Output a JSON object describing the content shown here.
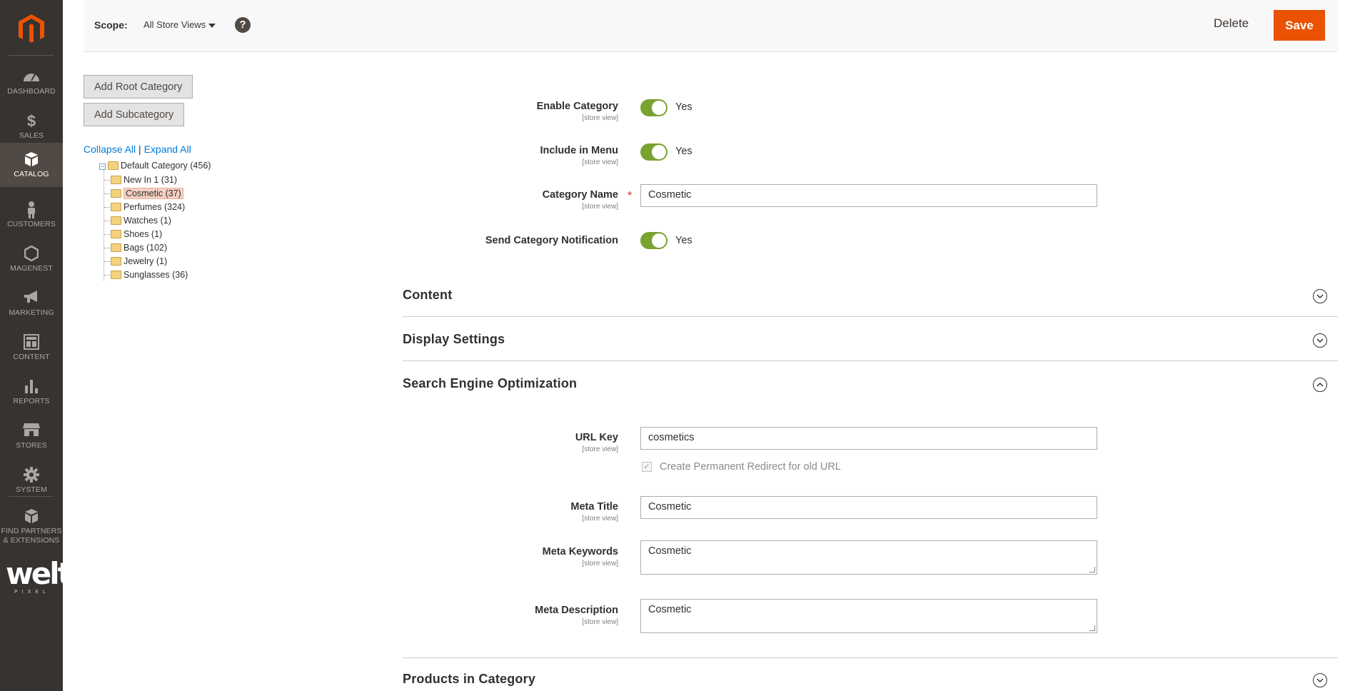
{
  "nav": {
    "items": [
      {
        "label": "DASHBOARD",
        "icon": "dashboard-gauge-icon"
      },
      {
        "label": "SALES",
        "icon": "dollar-icon"
      },
      {
        "label": "CATALOG",
        "icon": "box-icon"
      },
      {
        "label": "CUSTOMERS",
        "icon": "person-icon"
      },
      {
        "label": "MAGENEST",
        "icon": "hexagon-icon"
      },
      {
        "label": "MARKETING",
        "icon": "megaphone-icon"
      },
      {
        "label": "CONTENT",
        "icon": "layout-icon"
      },
      {
        "label": "REPORTS",
        "icon": "bar-chart-icon"
      },
      {
        "label": "STORES",
        "icon": "storefront-icon"
      },
      {
        "label": "SYSTEM",
        "icon": "gear-icon"
      }
    ],
    "partners_line1": "FIND PARTNERS",
    "partners_line2": "& EXTENSIONS",
    "brand_big": "welt",
    "brand_small": "PIXEL",
    "active": "CATALOG",
    "active_color": "#514943",
    "bg_color": "#373330"
  },
  "topbar": {
    "scope_label": "Scope:",
    "scope_value": "All Store Views",
    "help": "?",
    "delete_label": "Delete",
    "save_label": "Save",
    "save_color": "#eb5202"
  },
  "tree": {
    "add_root_label": "Add Root Category",
    "add_sub_label": "Add Subcategory",
    "collapse_all": "Collapse All",
    "separator": "|",
    "expand_all": "Expand All",
    "root": "Default Category (456)",
    "children": [
      "New In 1 (31)",
      "Cosmetic (37)",
      "Perfumes (324)",
      "Watches (1)",
      "Shoes (1)",
      "Bags (102)",
      "Jewelry (1)",
      "Sunglasses (36)"
    ],
    "selected": "Cosmetic (37)"
  },
  "form": {
    "enable_category": {
      "label": "Enable Category",
      "scope": "[store view]",
      "value": "Yes"
    },
    "include_in_menu": {
      "label": "Include in Menu",
      "scope": "[store view]",
      "value": "Yes"
    },
    "category_name": {
      "label": "Category Name",
      "scope": "[store view]",
      "required": "*",
      "value": "Cosmetic"
    },
    "send_notification": {
      "label": "Send Category Notification",
      "value": "Yes"
    },
    "toggle_color": "#79a22e"
  },
  "sections": {
    "content": "Content",
    "display_settings": "Display Settings",
    "seo": "Search Engine Optimization",
    "products": "Products in Category"
  },
  "seo": {
    "url_key": {
      "label": "URL Key",
      "scope": "[store view]",
      "value": "cosmetics"
    },
    "redirect_label": "Create Permanent Redirect for old URL",
    "redirect_checked": "✓",
    "meta_title": {
      "label": "Meta Title",
      "scope": "[store view]",
      "value": "Cosmetic"
    },
    "meta_keywords": {
      "label": "Meta Keywords",
      "scope": "[store view]",
      "value": "Cosmetic"
    },
    "meta_description": {
      "label": "Meta Description",
      "scope": "[store view]",
      "value": "Cosmetic"
    }
  }
}
